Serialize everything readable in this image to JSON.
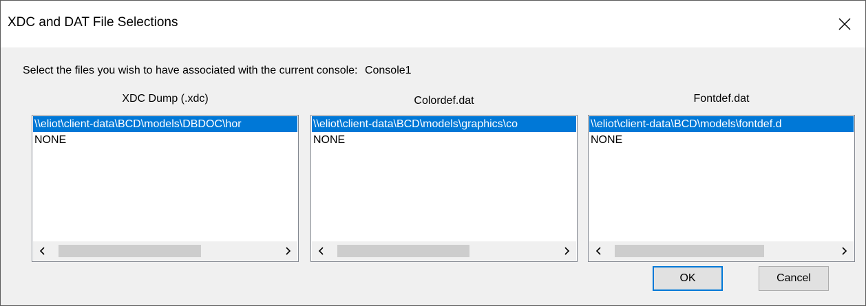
{
  "dialog": {
    "title": "XDC and DAT File Selections",
    "prompt": "Select the files you wish to have associated with the current console:",
    "console_name": "Console1"
  },
  "lists": [
    {
      "title": "XDC Dump (.xdc)",
      "items": [
        "\\\\eliot\\client-data\\BCD\\models\\DBDOC\\hor",
        "NONE"
      ],
      "selected_index": 0
    },
    {
      "title": "Colordef.dat",
      "items": [
        "\\\\eliot\\client-data\\BCD\\models\\graphics\\co",
        "NONE"
      ],
      "selected_index": 0
    },
    {
      "title": "Fontdef.dat",
      "items": [
        "\\\\eliot\\client-data\\BCD\\models\\fontdef.d",
        "NONE"
      ],
      "selected_index": 0
    }
  ],
  "buttons": {
    "ok": "OK",
    "cancel": "Cancel"
  },
  "icons": {
    "close": "close-icon",
    "scroll_left": "chevron-left-icon",
    "scroll_right": "chevron-right-icon"
  },
  "colors": {
    "selection": "#0078d7",
    "dialog_bg": "#f0f0f0"
  }
}
